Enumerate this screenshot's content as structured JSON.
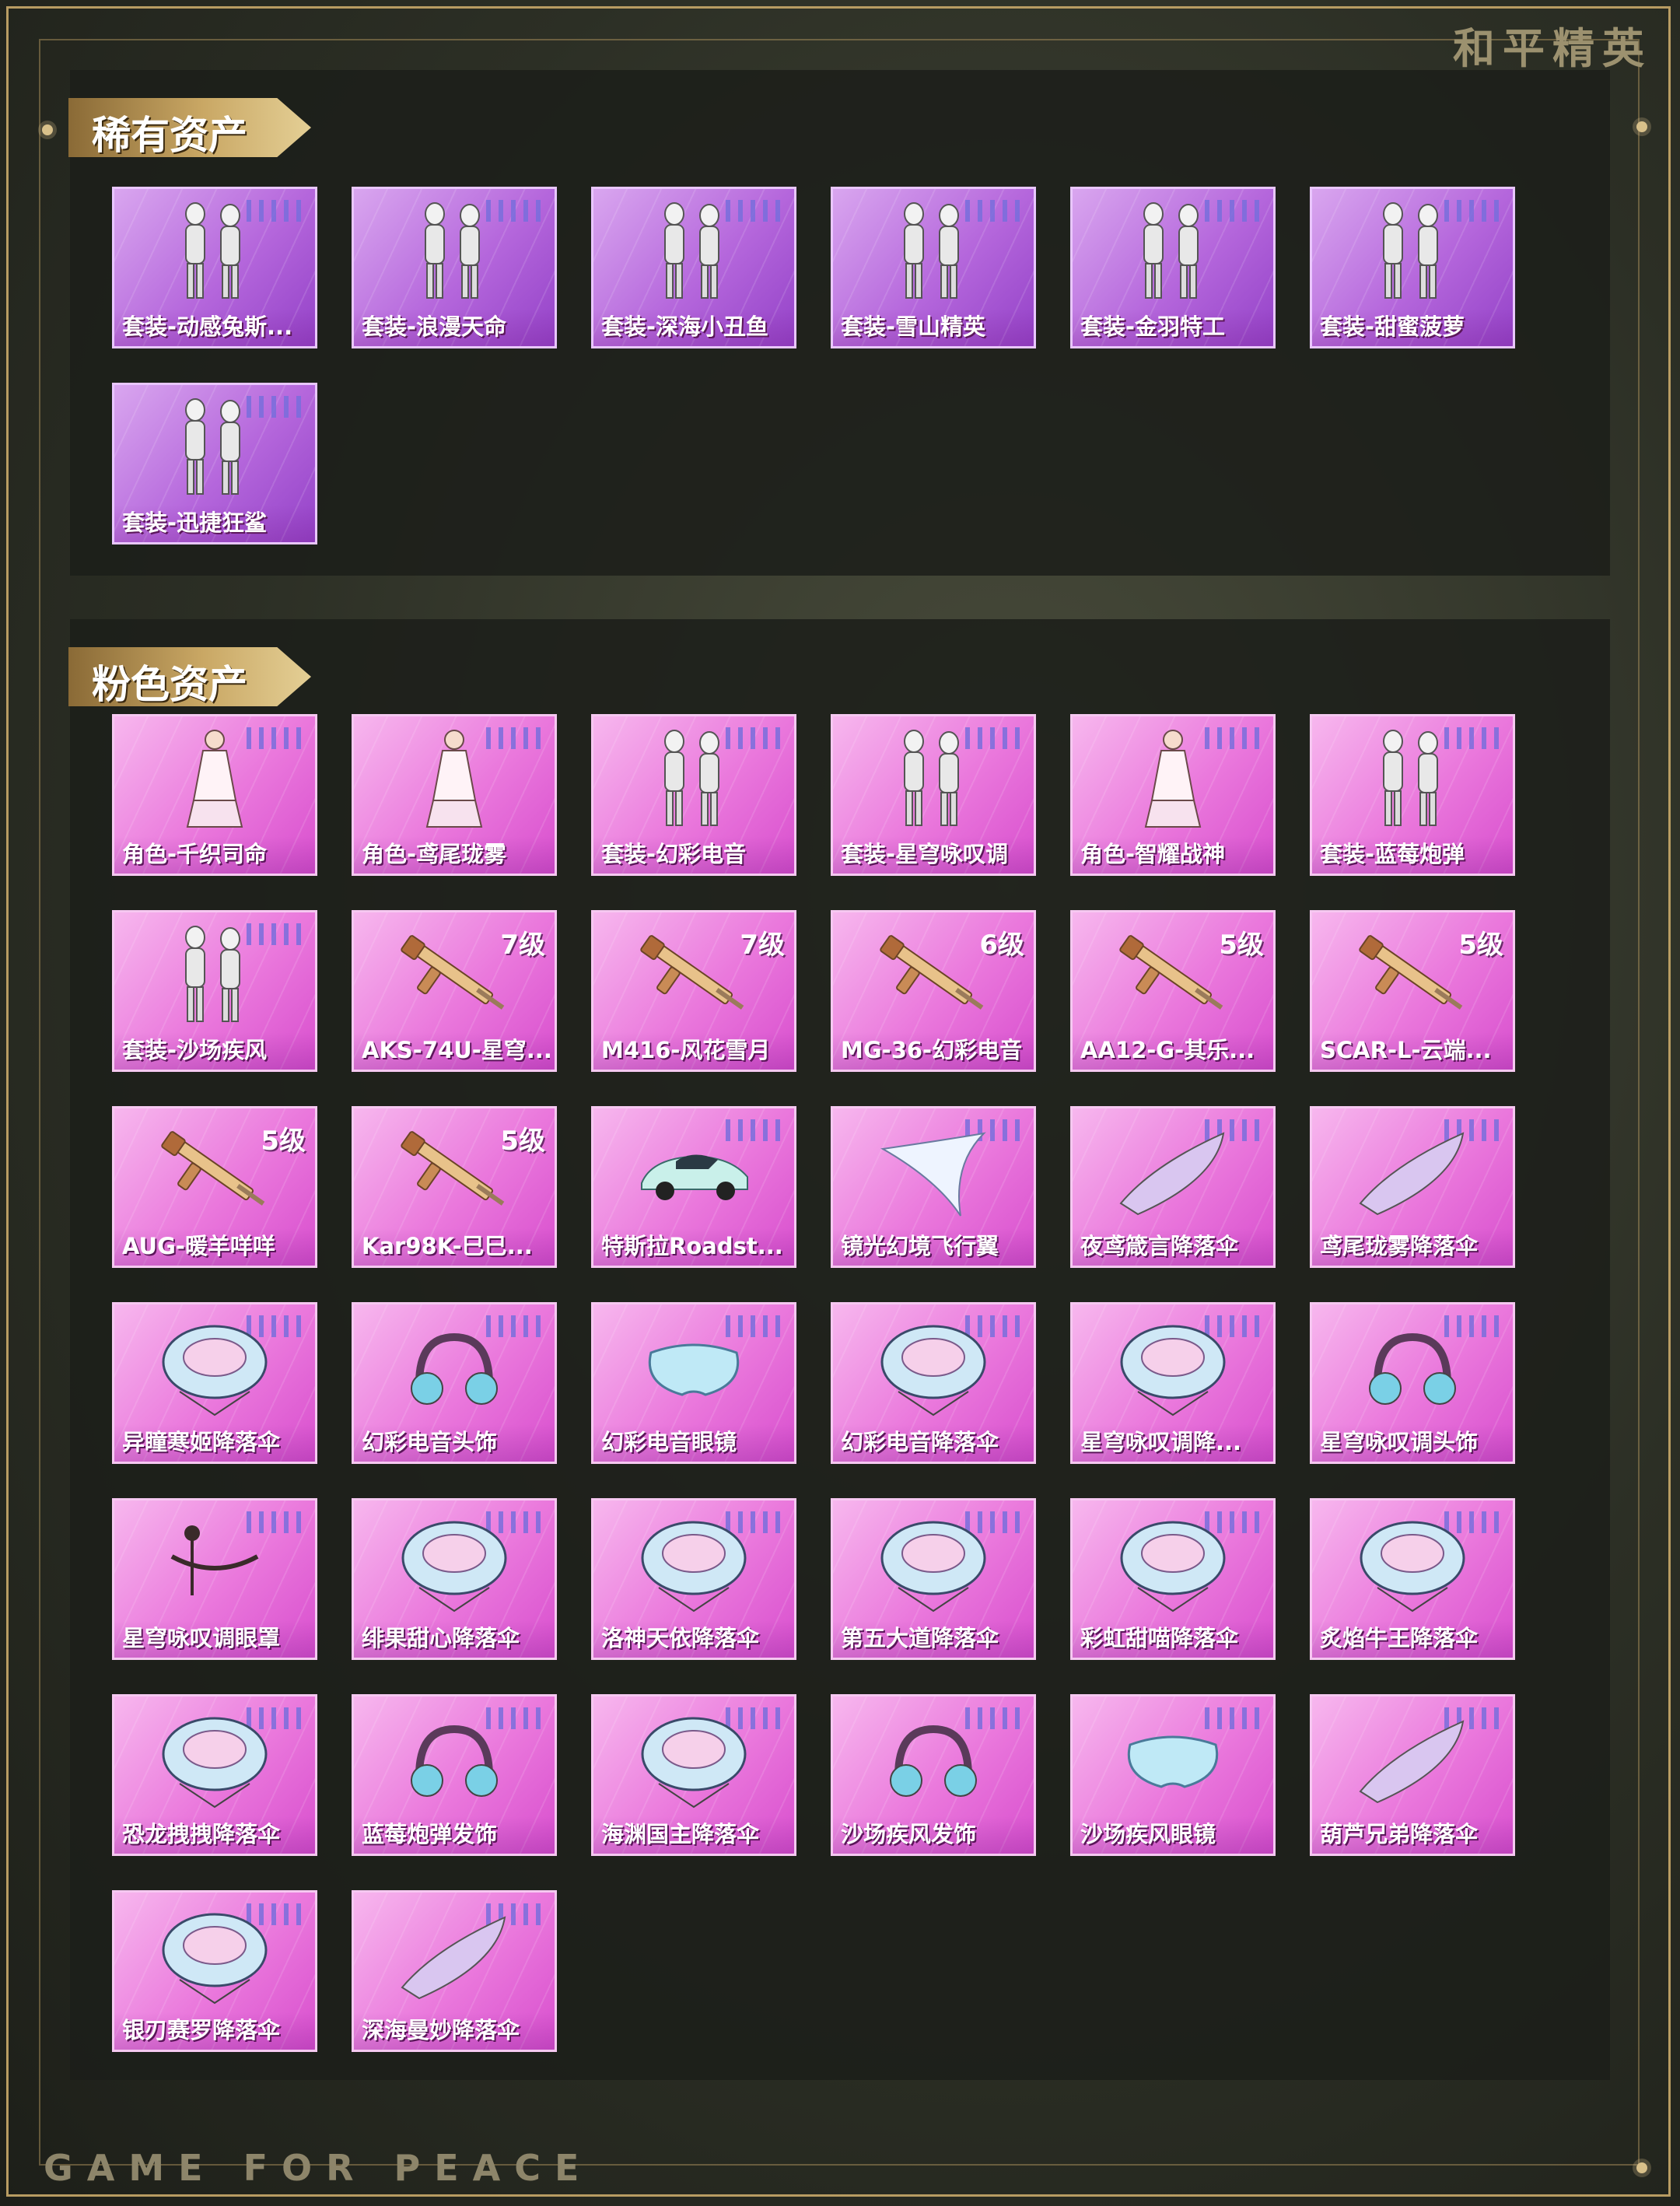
{
  "brand": {
    "cn": "和平精英",
    "en": "GAME FOR PEACE"
  },
  "sections": {
    "rare": {
      "title": "稀有资产",
      "items": [
        {
          "label": "套装-动感兔斯...",
          "icon": "outfit-icon",
          "level": ""
        },
        {
          "label": "套装-浪漫天命",
          "icon": "outfit-icon",
          "level": ""
        },
        {
          "label": "套装-深海小丑鱼",
          "icon": "outfit-icon",
          "level": ""
        },
        {
          "label": "套装-雪山精英",
          "icon": "outfit-icon",
          "level": ""
        },
        {
          "label": "套装-金羽特工",
          "icon": "outfit-icon",
          "level": ""
        },
        {
          "label": "套装-甜蜜菠萝",
          "icon": "outfit-icon",
          "level": ""
        },
        {
          "label": "套装-迅捷狂鲨",
          "icon": "outfit-icon",
          "level": ""
        }
      ]
    },
    "pink": {
      "title": "粉色资产",
      "items": [
        {
          "label": "角色-千织司命",
          "icon": "character-icon",
          "level": ""
        },
        {
          "label": "角色-鸢尾珑雾",
          "icon": "character-icon",
          "level": ""
        },
        {
          "label": "套装-幻彩电音",
          "icon": "outfit-icon",
          "level": ""
        },
        {
          "label": "套装-星穹咏叹调",
          "icon": "outfit-icon",
          "level": ""
        },
        {
          "label": "角色-智耀战神",
          "icon": "character-icon",
          "level": ""
        },
        {
          "label": "套装-蓝莓炮弹",
          "icon": "outfit-icon",
          "level": ""
        },
        {
          "label": "套装-沙场疾风",
          "icon": "outfit-icon",
          "level": ""
        },
        {
          "label": "AKS-74U-星穹...",
          "icon": "rifle-icon",
          "level": "7级"
        },
        {
          "label": "M416-风花雪月",
          "icon": "rifle-icon",
          "level": "7级"
        },
        {
          "label": "MG-36-幻彩电音",
          "icon": "rifle-icon",
          "level": "6级"
        },
        {
          "label": "AA12-G-其乐...",
          "icon": "rifle-icon",
          "level": "5级"
        },
        {
          "label": "SCAR-L-云端...",
          "icon": "rifle-icon",
          "level": "5级"
        },
        {
          "label": "AUG-暖羊咩咩",
          "icon": "rifle-icon",
          "level": "5级"
        },
        {
          "label": "Kar98K-巳巳...",
          "icon": "rifle-icon",
          "level": "5级"
        },
        {
          "label": "特斯拉Roadst...",
          "icon": "car-icon",
          "level": ""
        },
        {
          "label": "镜光幻境飞行翼",
          "icon": "wing-icon",
          "level": ""
        },
        {
          "label": "夜鸢箴言降落伞",
          "icon": "glider-icon",
          "level": ""
        },
        {
          "label": "鸢尾珑雾降落伞",
          "icon": "glider-icon",
          "level": ""
        },
        {
          "label": "异瞳寒姬降落伞",
          "icon": "parachute-icon",
          "level": ""
        },
        {
          "label": "幻彩电音头饰",
          "icon": "headwear-icon",
          "level": ""
        },
        {
          "label": "幻彩电音眼镜",
          "icon": "glasses-icon",
          "level": ""
        },
        {
          "label": "幻彩电音降落伞",
          "icon": "parachute-icon",
          "level": ""
        },
        {
          "label": "星穹咏叹调降...",
          "icon": "parachute-icon",
          "level": ""
        },
        {
          "label": "星穹咏叹调头饰",
          "icon": "headwear-icon",
          "level": ""
        },
        {
          "label": "星穹咏叹调眼罩",
          "icon": "mask-icon",
          "level": ""
        },
        {
          "label": "绯果甜心降落伞",
          "icon": "parachute-icon",
          "level": ""
        },
        {
          "label": "洛神天依降落伞",
          "icon": "parachute-icon",
          "level": ""
        },
        {
          "label": "第五大道降落伞",
          "icon": "parachute-icon",
          "level": ""
        },
        {
          "label": "彩虹甜喵降落伞",
          "icon": "parachute-icon",
          "level": ""
        },
        {
          "label": "炙焰牛王降落伞",
          "icon": "parachute-icon",
          "level": ""
        },
        {
          "label": "恐龙拽拽降落伞",
          "icon": "parachute-icon",
          "level": ""
        },
        {
          "label": "蓝莓炮弹发饰",
          "icon": "headwear-icon",
          "level": ""
        },
        {
          "label": "海渊国主降落伞",
          "icon": "parachute-icon",
          "level": ""
        },
        {
          "label": "沙场疾风发饰",
          "icon": "headwear-icon",
          "level": ""
        },
        {
          "label": "沙场疾风眼镜",
          "icon": "glasses-icon",
          "level": ""
        },
        {
          "label": "葫芦兄弟降落伞",
          "icon": "glider-icon",
          "level": ""
        },
        {
          "label": "银刃赛罗降落伞",
          "icon": "parachute-icon",
          "level": ""
        },
        {
          "label": "深海曼妙降落伞",
          "icon": "glider-icon",
          "level": ""
        }
      ]
    }
  }
}
